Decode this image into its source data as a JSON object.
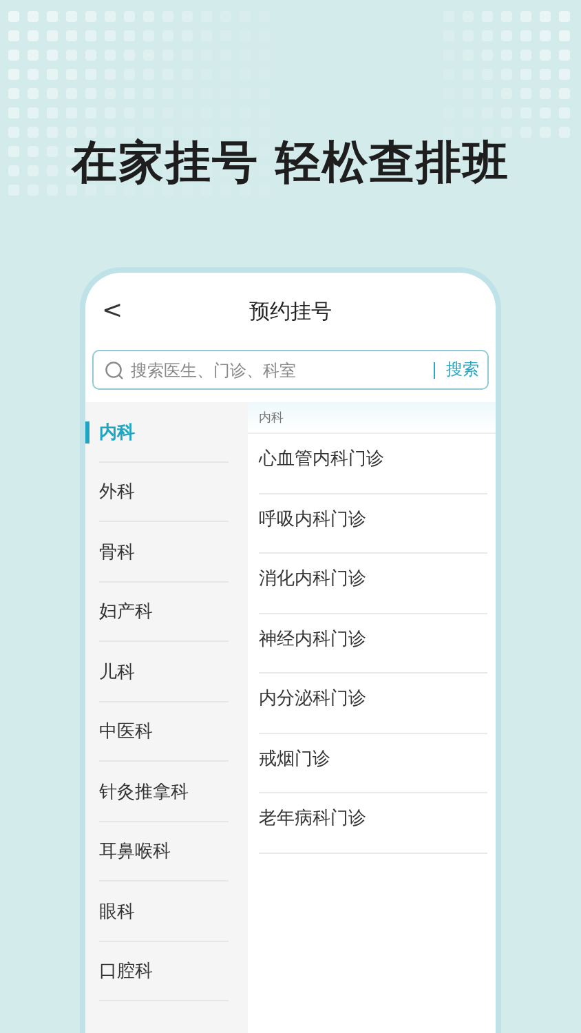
{
  "headline": "在家挂号 轻松查排班",
  "header": {
    "back": "<",
    "title": "预约挂号"
  },
  "search": {
    "placeholder": "搜索医生、门诊、科室",
    "button": "搜索"
  },
  "departments": [
    {
      "label": "内科",
      "selected": true
    },
    {
      "label": "外科",
      "selected": false
    },
    {
      "label": "骨科",
      "selected": false
    },
    {
      "label": "妇产科",
      "selected": false
    },
    {
      "label": "儿科",
      "selected": false
    },
    {
      "label": "中医科",
      "selected": false
    },
    {
      "label": "针灸推拿科",
      "selected": false
    },
    {
      "label": "耳鼻喉科",
      "selected": false
    },
    {
      "label": "眼科",
      "selected": false
    },
    {
      "label": "口腔科",
      "selected": false
    }
  ],
  "clinics": {
    "heading": "内科",
    "items": [
      "心血管内科门诊",
      "呼吸内科门诊",
      "消化内科门诊",
      "神经内科门诊",
      "内分泌科门诊",
      "戒烟门诊",
      "老年病科门诊"
    ]
  }
}
